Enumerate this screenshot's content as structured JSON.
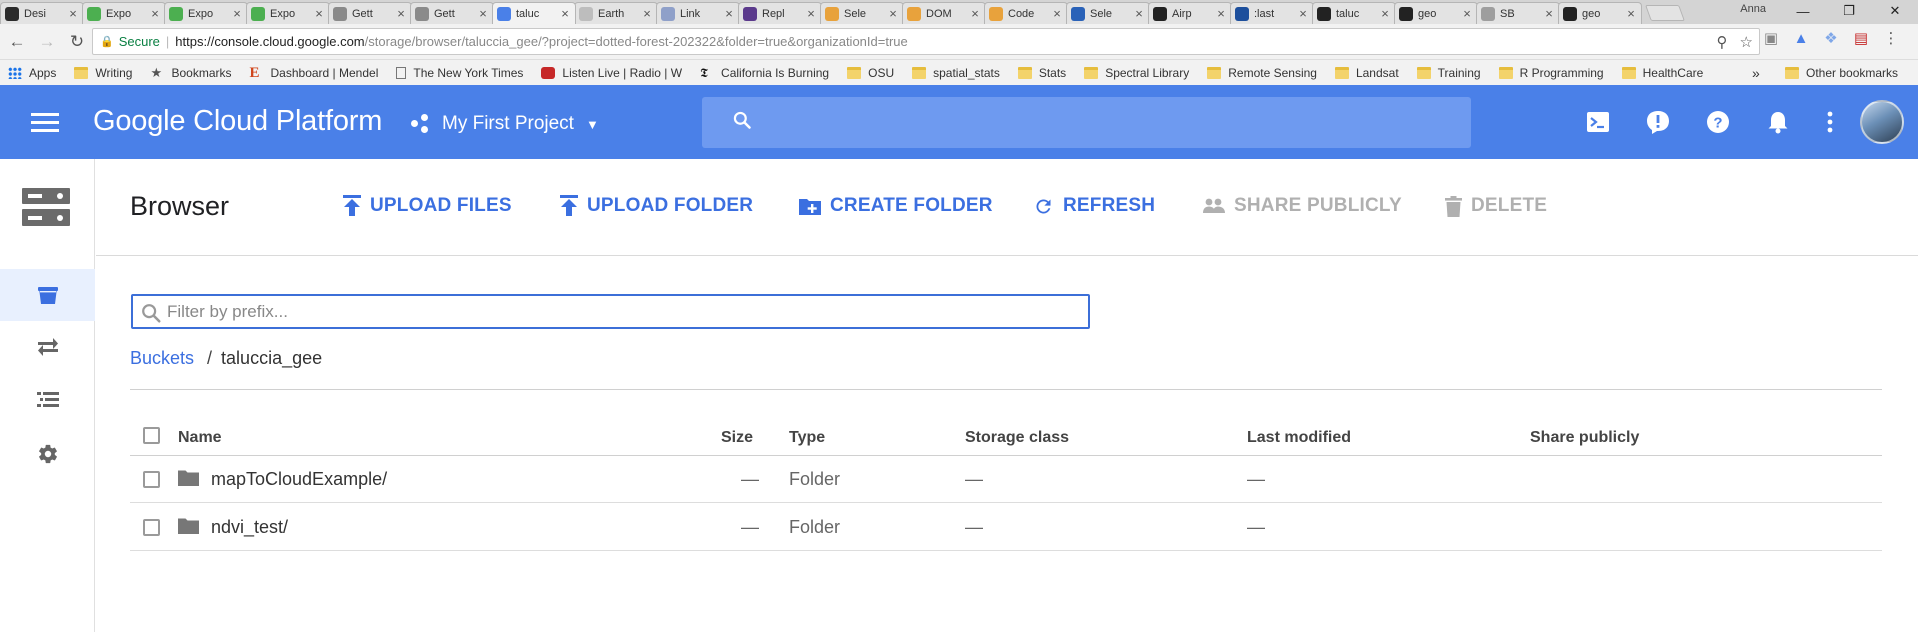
{
  "browser": {
    "tabs": [
      {
        "title": "Desi",
        "fav": "#2b2b2b"
      },
      {
        "title": "Expo",
        "fav": "#4caf50"
      },
      {
        "title": "Expo",
        "fav": "#4caf50"
      },
      {
        "title": "Expo",
        "fav": "#4caf50"
      },
      {
        "title": "Gett",
        "fav": "#8a8a8a"
      },
      {
        "title": "Gett",
        "fav": "#8a8a8a"
      },
      {
        "title": "taluc",
        "fav": "#4a80e8"
      },
      {
        "title": "Earth",
        "fav": "#bdbdbd"
      },
      {
        "title": "Link",
        "fav": "#8fa0c9"
      },
      {
        "title": "Repl",
        "fav": "#5b3a8c"
      },
      {
        "title": "Sele",
        "fav": "#e8a23c"
      },
      {
        "title": "DOM",
        "fav": "#e8a23c"
      },
      {
        "title": "Code",
        "fav": "#e8a23c"
      },
      {
        "title": "Sele",
        "fav": "#2a62b8"
      },
      {
        "title": "Airp",
        "fav": "#222222"
      },
      {
        "title": ":last",
        "fav": "#1d4f9c"
      },
      {
        "title": "taluc",
        "fav": "#222222"
      },
      {
        "title": "geo",
        "fav": "#222222"
      },
      {
        "title": "SB",
        "fav": "#9e9e9e"
      },
      {
        "title": "geo",
        "fav": "#222222"
      }
    ],
    "active_tab_index": 6,
    "profile_name": "Anna",
    "secure_label": "Secure",
    "url_host": "https://console.cloud.google.com",
    "url_path": "/storage/browser/taluccia_gee/?project=dotted-forest-202322&folder=true&organizationId=true",
    "bookmarks": [
      {
        "label": "Apps",
        "icon": "apps-grid-icon"
      },
      {
        "label": "Writing",
        "icon": "folder-icon"
      },
      {
        "label": "Bookmarks",
        "icon": "star-icon"
      },
      {
        "label": "Dashboard | Mendel",
        "icon": "mendeley-icon"
      },
      {
        "label": "The New York Times",
        "icon": "page-icon"
      },
      {
        "label": "Listen Live | Radio | W",
        "icon": "radio-icon"
      },
      {
        "label": "California Is Burning",
        "icon": "nyt-icon"
      },
      {
        "label": "OSU",
        "icon": "folder-icon"
      },
      {
        "label": "spatial_stats",
        "icon": "folder-icon"
      },
      {
        "label": "Stats",
        "icon": "folder-icon"
      },
      {
        "label": "Spectral Library",
        "icon": "folder-icon"
      },
      {
        "label": "Remote Sensing",
        "icon": "folder-icon"
      },
      {
        "label": "Landsat",
        "icon": "folder-icon"
      },
      {
        "label": "Training",
        "icon": "folder-icon"
      },
      {
        "label": "R Programming",
        "icon": "folder-icon"
      },
      {
        "label": "HealthCare",
        "icon": "folder-icon"
      }
    ],
    "bookmarks_overflow": "»",
    "other_bookmarks": "Other bookmarks"
  },
  "header": {
    "brand": "Google Cloud Platform",
    "project_name": "My First Project",
    "search_placeholder": ""
  },
  "toolbar": {
    "title": "Browser",
    "upload_files": "UPLOAD FILES",
    "upload_folder": "UPLOAD FOLDER",
    "create_folder": "CREATE FOLDER",
    "refresh": "REFRESH",
    "share_publicly": "SHARE PUBLICLY",
    "delete": "DELETE"
  },
  "filter": {
    "placeholder": "Filter by prefix...",
    "value": ""
  },
  "breadcrumb": {
    "root": "Buckets",
    "separator": "/",
    "current": "taluccia_gee"
  },
  "table": {
    "columns": [
      "Name",
      "Size",
      "Type",
      "Storage class",
      "Last modified",
      "Share publicly"
    ],
    "rows": [
      {
        "name": "mapToCloudExample/",
        "size": "—",
        "type": "Folder",
        "storage_class": "—",
        "last_modified": "—",
        "share": ""
      },
      {
        "name": "ndvi_test/",
        "size": "—",
        "type": "Folder",
        "storage_class": "—",
        "last_modified": "—",
        "share": ""
      }
    ]
  },
  "colors": {
    "header_blue": "#4a80e8",
    "action_blue": "#3b6fe0",
    "disabled": "#b0b0b0"
  }
}
